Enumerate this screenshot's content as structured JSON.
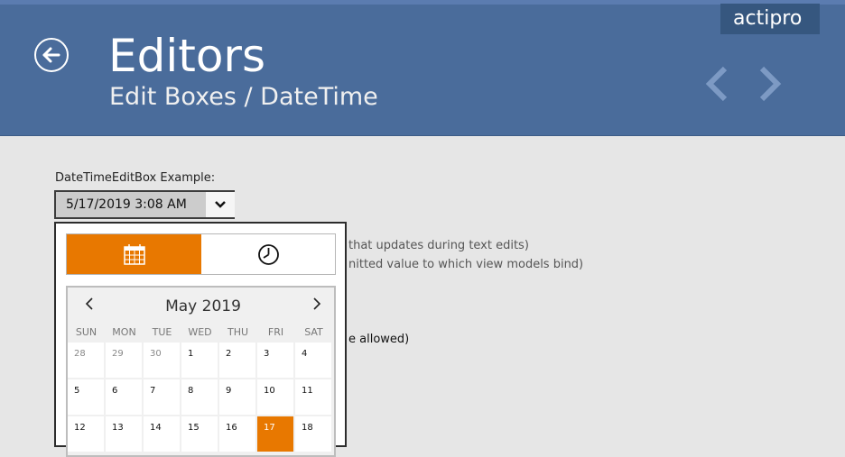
{
  "header": {
    "title": "Editors",
    "breadcrumb": "Edit Boxes / DateTime",
    "logo": "actipro",
    "back_icon": "back-arrow-circle-icon",
    "prev_icon": "chevron-left-icon",
    "next_icon": "chevron-right-icon"
  },
  "editor": {
    "label": "DateTimeEditBox Example:",
    "value": "5/17/2019 3:08 AM",
    "dropdown_icon": "chevron-down-icon"
  },
  "background_text": {
    "line1": "that updates during text edits)",
    "line2": "nitted value to which view models bind)",
    "line3": "e allowed)"
  },
  "popup": {
    "tabs": [
      {
        "icon": "calendar-icon",
        "selected": true
      },
      {
        "icon": "clock-icon",
        "selected": false
      }
    ],
    "calendar": {
      "month_label": "May 2019",
      "prev_icon": "chevron-left-icon",
      "next_icon": "chevron-right-icon",
      "weekdays": [
        "SUN",
        "MON",
        "TUE",
        "WED",
        "THU",
        "FRI",
        "SAT"
      ],
      "weeks": [
        [
          "28",
          "29",
          "30",
          "1",
          "2",
          "3",
          "4"
        ],
        [
          "5",
          "6",
          "7",
          "8",
          "9",
          "10",
          "11"
        ],
        [
          "12",
          "13",
          "14",
          "15",
          "16",
          "17",
          "18"
        ]
      ],
      "other_month_days": [
        "28",
        "29",
        "30"
      ],
      "selected_day": "17"
    }
  },
  "colors": {
    "header_bg": "#4a6c9b",
    "accent": "#e87800",
    "page_bg": "#e6e6e6"
  }
}
